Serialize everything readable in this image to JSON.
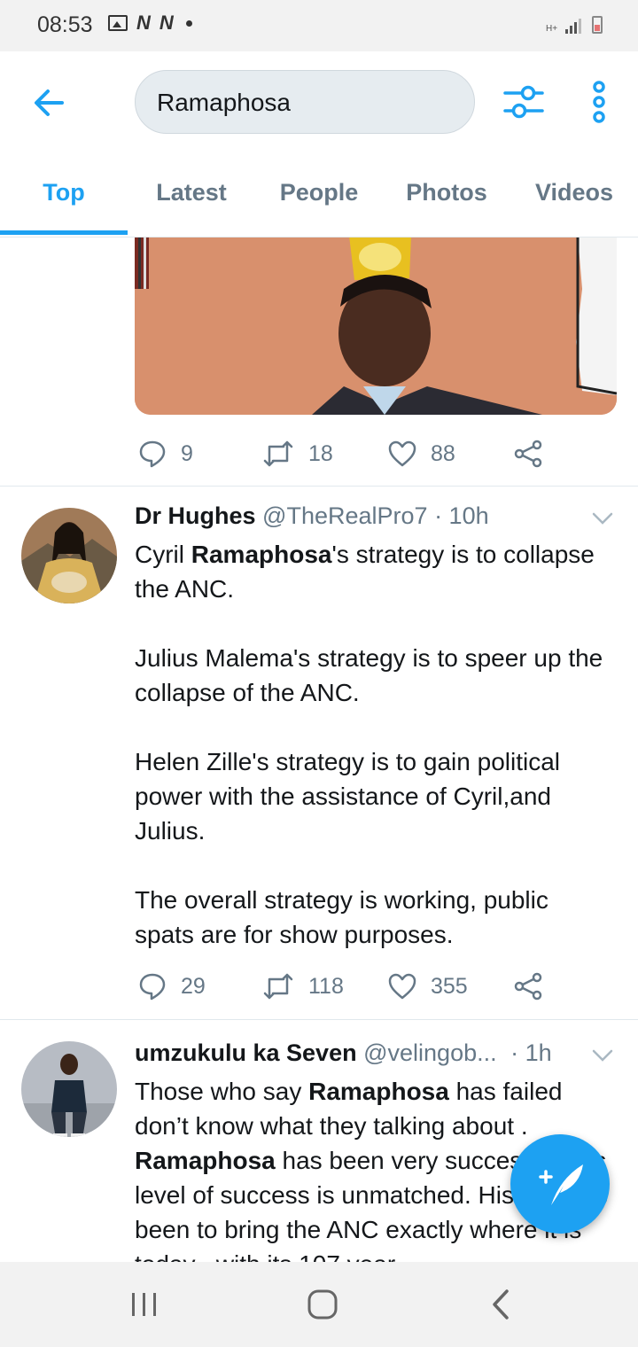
{
  "status_bar": {
    "time": "08:53",
    "carrier_icon_1": "N",
    "carrier_icon_2": "N",
    "network_label": "H+"
  },
  "header": {
    "search_query": "Ramaphosa",
    "icons": [
      "back-arrow-icon",
      "filter-sliders-icon",
      "more-vertical-icon"
    ],
    "accent_color": "#1da1f2"
  },
  "tabs": [
    {
      "label": "Top",
      "active": true
    },
    {
      "label": "Latest",
      "active": false
    },
    {
      "label": "People",
      "active": false
    },
    {
      "label": "Photos",
      "active": false
    },
    {
      "label": "Videos",
      "active": false
    }
  ],
  "tweets": [
    {
      "replies": "9",
      "retweets": "18",
      "likes": "88"
    },
    {
      "name": "Dr Hughes",
      "handle": "@TheRealPro7",
      "time": "· 10h",
      "body_p1_a": "Cyril ",
      "body_p1_b": "Ramaphosa",
      "body_p1_c": "'s strategy is to collapse the ANC.",
      "body_p2": "Julius Malema's strategy is to speer up the collapse of the ANC.",
      "body_p3": "Helen Zille's strategy is to gain political power with the assistance of Cyril,and Julius.",
      "body_p4": "The overall strategy is working, public spats are for show purposes.",
      "replies": "29",
      "retweets": "118",
      "likes": "355"
    },
    {
      "name": "umzukulu ka Seven",
      "handle": "@velingob...",
      "time": "· 1h",
      "body_a": "Those who say ",
      "body_b": "Ramaphosa",
      "body_c": " has failed don’t know what they talking about . ",
      "body_d": "Ramaphosa",
      "body_e": " has been very successful, his level of success is unmatched. His aim has been to bring the ANC exactly where it is today , with its 107 year"
    }
  ],
  "nav_bar": {
    "icons": [
      "recent-apps-icon",
      "home-icon",
      "back-icon"
    ]
  }
}
